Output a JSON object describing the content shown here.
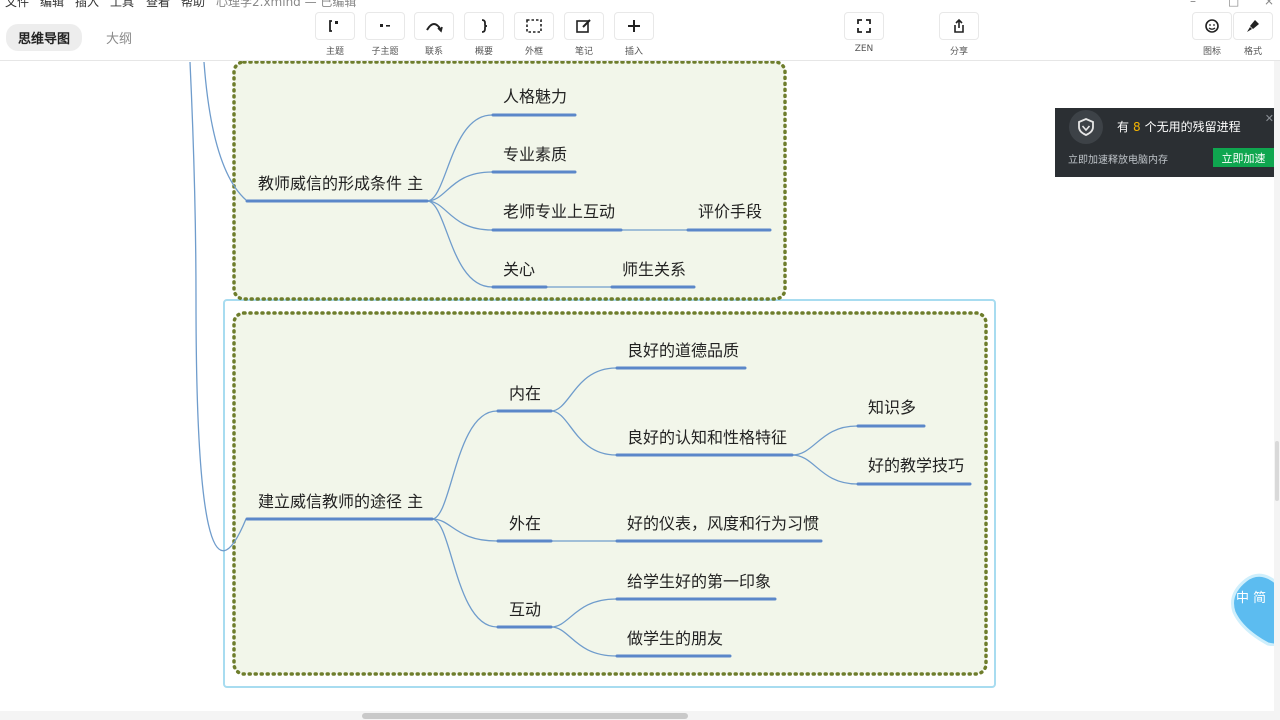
{
  "menu": {
    "items": [
      "文件",
      "编辑",
      "插入",
      "工具",
      "查看",
      "帮助"
    ],
    "doc_title": "心理学2.xmind — 已编辑"
  },
  "view_tabs": {
    "mindmap": "思维导图",
    "outline": "大纲"
  },
  "toolbar": {
    "topic": "主题",
    "subtopic": "子主题",
    "relationship": "联系",
    "summary": "概要",
    "boundary": "外框",
    "note": "笔记",
    "insert": "插入",
    "zen": "ZEN",
    "share": "分享",
    "icon": "图标",
    "format": "格式"
  },
  "mindmap": {
    "group1": {
      "main": "教师威信的形成条件 主",
      "children": [
        "人格魅力",
        "专业素质",
        "老师专业上互动",
        "关心"
      ],
      "sub_children": {
        "interaction": "评价手段",
        "care": "师生关系"
      }
    },
    "group2": {
      "main": "建立威信教师的途径  主",
      "inner": {
        "label": "内在",
        "children": [
          "良好的道德品质",
          "良好的认知和性格特征"
        ],
        "cognition_children": [
          "知识多",
          "好的教学技巧"
        ]
      },
      "outer": {
        "label": "外在",
        "child": "好的仪表，风度和行为习惯"
      },
      "interact": {
        "label": "互动",
        "children": [
          "给学生好的第一印象",
          "做学生的朋友"
        ]
      }
    }
  },
  "popup": {
    "prefix": "有",
    "count": "8",
    "suffix": "个无用的残留进程",
    "sub": "立即加速释放电脑内存",
    "button": "立即加速"
  },
  "watermark": {
    "text": "中 简"
  },
  "colors": {
    "line": "#6f9ccc",
    "underline": "#5b87c9",
    "boundary_fill": "#f2f6ea",
    "boundary_border": "#6e7d2c",
    "selection": "#a8dcf0",
    "popup_bg": "#2b2f33",
    "popup_button": "#0fa64f",
    "popup_count": "#f5b400"
  }
}
